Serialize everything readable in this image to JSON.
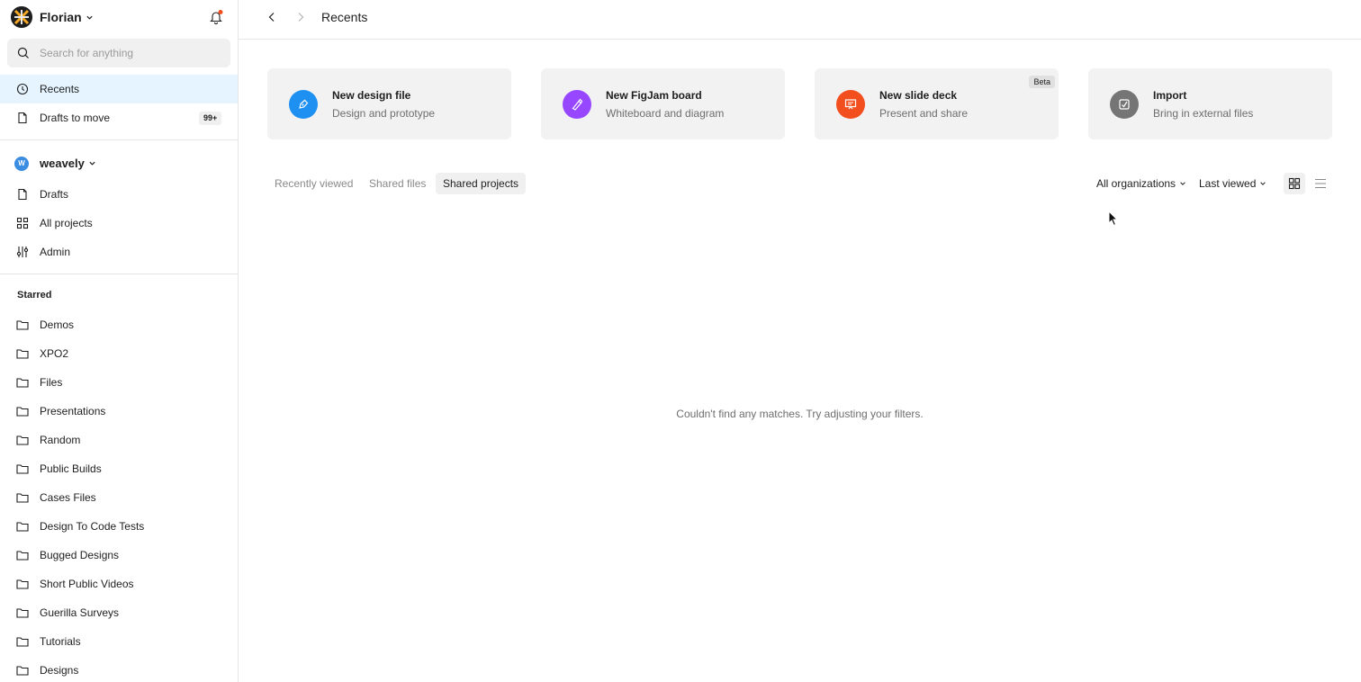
{
  "user": {
    "name": "Florian"
  },
  "search": {
    "placeholder": "Search for anything"
  },
  "nav": {
    "recents": "Recents",
    "drafts_to_move": "Drafts to move",
    "drafts_badge": "99+"
  },
  "org": {
    "initial": "W",
    "name": "weavely",
    "items": [
      "Drafts",
      "All projects",
      "Admin"
    ]
  },
  "starred": {
    "title": "Starred",
    "items": [
      "Demos",
      "XPO2",
      "Files",
      "Presentations",
      "Random",
      "Public Builds",
      "Cases Files",
      "Design To Code Tests",
      "Bugged Designs",
      "Short Public Videos",
      "Guerilla Surveys",
      "Tutorials",
      "Designs"
    ]
  },
  "header": {
    "breadcrumb": "Recents"
  },
  "cards": [
    {
      "title": "New design file",
      "subtitle": "Design and prototype",
      "color": "#1e90f2",
      "icon": "pen-icon"
    },
    {
      "title": "New FigJam board",
      "subtitle": "Whiteboard and diagram",
      "color": "#9747ff",
      "icon": "marker-icon"
    },
    {
      "title": "New slide deck",
      "subtitle": "Present and share",
      "color": "#f24e1e",
      "icon": "presentation-icon",
      "badge": "Beta"
    },
    {
      "title": "Import",
      "subtitle": "Bring in external files",
      "color": "#757575",
      "icon": "import-icon"
    }
  ],
  "tabs": [
    "Recently viewed",
    "Shared files",
    "Shared projects"
  ],
  "selected_tab": "Shared projects",
  "filters": {
    "organizations": "All organizations",
    "sort": "Last viewed"
  },
  "empty_message": "Couldn't find any matches. Try adjusting your filters.",
  "colors": {
    "accent": "#e5f4ff",
    "notification_dot": "#f24e1e"
  }
}
